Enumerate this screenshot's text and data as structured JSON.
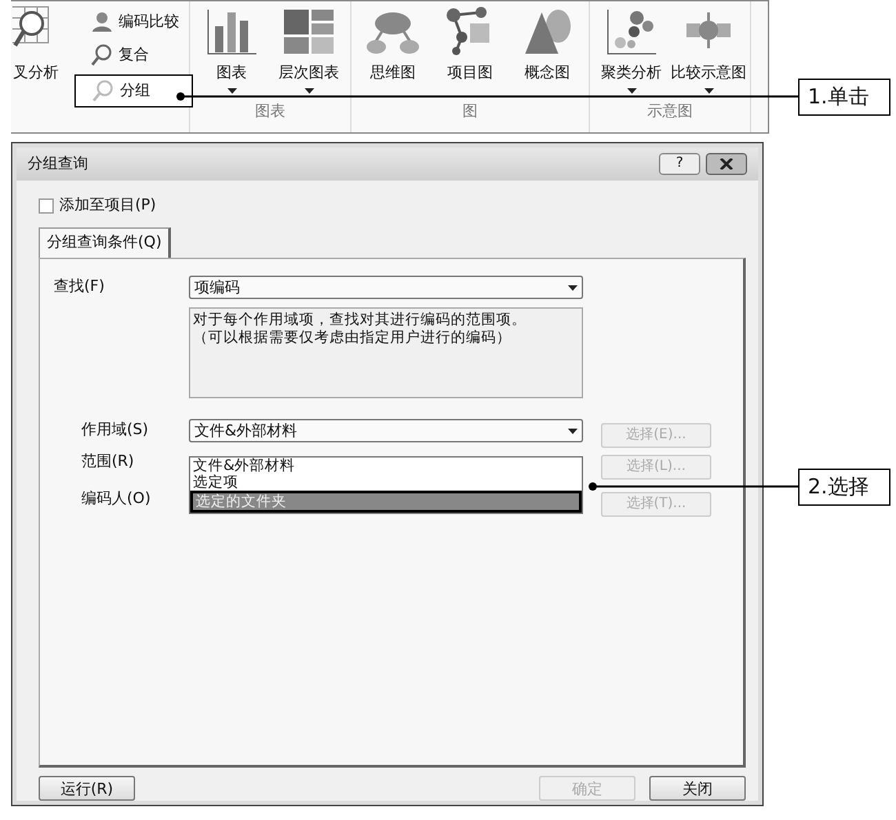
{
  "ribbon": {
    "partial_item": {
      "label": "叉分析"
    },
    "small_items": [
      {
        "kind": "compare",
        "label": "编码比较",
        "boxed": false
      },
      {
        "kind": "compound",
        "label": "复合",
        "boxed": false
      },
      {
        "kind": "group",
        "label": "分组",
        "boxed": true
      }
    ],
    "groups": [
      {
        "label": "图表",
        "items": [
          {
            "kind": "bars",
            "label": "图表",
            "dropdown": true
          },
          {
            "kind": "treemap",
            "label": "层次图表",
            "dropdown": true
          }
        ]
      },
      {
        "label": "图",
        "items": [
          {
            "kind": "mindmap",
            "label": "思维图",
            "dropdown": false
          },
          {
            "kind": "projectmap",
            "label": "项目图",
            "dropdown": false
          },
          {
            "kind": "conceptmap",
            "label": "概念图",
            "dropdown": false
          }
        ]
      },
      {
        "label": "示意图",
        "items": [
          {
            "kind": "cluster",
            "label": "聚类分析",
            "dropdown": true
          },
          {
            "kind": "comparison",
            "label": "比较示意图",
            "dropdown": true
          }
        ]
      }
    ]
  },
  "dialog": {
    "title": "分组查询",
    "help_button": "?",
    "add_to_project": {
      "label": "添加至项目(P)",
      "checked": false
    },
    "tabs": [
      {
        "label": "分组查询条件(Q)",
        "selected": true
      }
    ],
    "find": {
      "label": "查找(F)",
      "value": "项编码",
      "description": [
        "对于每个作用域项，查找对其进行编码的范围项。",
        "（可以根据需要仅考虑由指定用户进行的编码）"
      ]
    },
    "scope": {
      "label": "作用域(S)",
      "value": "文件&外部材料",
      "select_button": "选择(E)..."
    },
    "scope_options": [
      {
        "label": "文件&外部材料",
        "selected": false
      },
      {
        "label": "选定项",
        "selected": false
      },
      {
        "label": "选定的文件夹",
        "selected": true
      }
    ],
    "range": {
      "label": "范围(R)",
      "select_button": "选择(L)..."
    },
    "coder": {
      "label": "编码人(O)",
      "select_button": "选择(T)..."
    },
    "buttons": [
      {
        "label": "运行(R)",
        "disabled": false
      },
      {
        "label": "确定",
        "disabled": true
      },
      {
        "label": "关闭",
        "disabled": false
      }
    ]
  },
  "callouts": [
    {
      "label": "1.单击"
    },
    {
      "label": "2.选择"
    }
  ]
}
